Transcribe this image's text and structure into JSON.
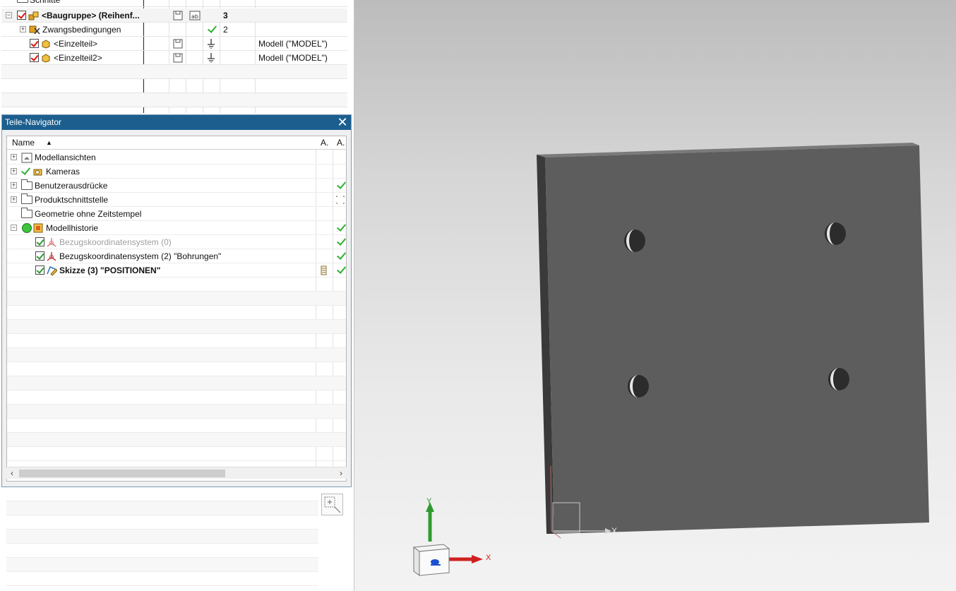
{
  "assembly_navigator": {
    "rows": [
      {
        "name": "Schnitte"
      },
      {
        "name": "<Baugruppe> (Reihenf...",
        "count": "3"
      },
      {
        "name": "Zwangsbedingungen",
        "count": "2"
      },
      {
        "name": "<Einzelteil>",
        "reference_set": "Modell (\"MODEL\")"
      },
      {
        "name": "<Einzelteil2>",
        "reference_set": "Modell (\"MODEL\")"
      }
    ]
  },
  "part_navigator": {
    "title": "Teile-Navigator",
    "columns": {
      "name": "Name",
      "col2": "A.",
      "col3": "A."
    },
    "rows": [
      {
        "name": "Modellansichten"
      },
      {
        "name": "Kameras"
      },
      {
        "name": "Benutzerausdrücke"
      },
      {
        "name": "Produktschnittstelle"
      },
      {
        "name": "Geometrie ohne Zeitstempel"
      },
      {
        "name": "Modellhistorie"
      },
      {
        "name": "Bezugskoordinatensystem (0)"
      },
      {
        "name": "Bezugskoordinatensystem (2) \"Bohrungen\""
      },
      {
        "name": "Skizze (3) \"POSITIONEN\""
      }
    ]
  },
  "viewport": {
    "triad": {
      "x_label": "X",
      "y_label": "Y"
    },
    "csys_label": "X"
  },
  "colors": {
    "title_bar": "#1c5f8f",
    "check_green": "#2fb02f",
    "plate": "#5d5d5d"
  }
}
